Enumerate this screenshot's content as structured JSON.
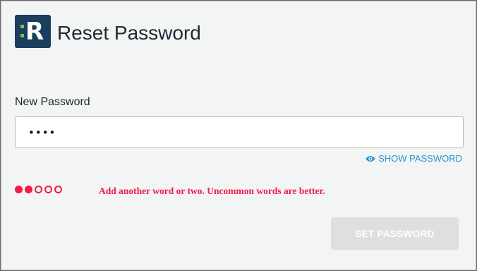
{
  "header": {
    "logo_icon": "resolver-logo-icon",
    "logo_letter": "R",
    "title": "Reset Password"
  },
  "form": {
    "new_password_label": "New Password",
    "new_password_value": "••••",
    "show_password_icon": "eye-icon",
    "show_password_label": "SHOW PASSWORD",
    "strength": {
      "filled": 2,
      "total": 5,
      "message": "Add another word or two. Uncommon words are better."
    },
    "submit_label": "SET PASSWORD",
    "submit_enabled": false
  },
  "colors": {
    "logo_bg": "#1c3e5e",
    "logo_accent": "#7bc143",
    "link": "#2896d3",
    "error": "#f01c4b",
    "button_disabled": "#dedfe0"
  }
}
